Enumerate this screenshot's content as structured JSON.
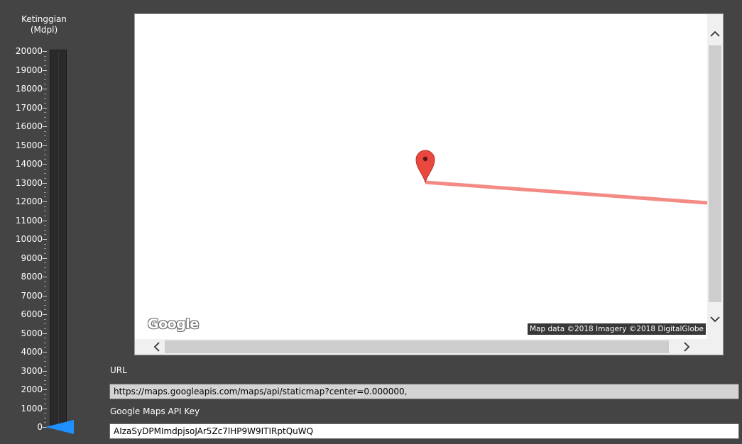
{
  "gauge": {
    "title_line1": "Ketinggian",
    "title_line2": "(Mdpl)",
    "scale_labels": [
      "20000",
      "19000",
      "18000",
      "17000",
      "16000",
      "15000",
      "14000",
      "13000",
      "12000",
      "11000",
      "10000",
      "9000",
      "8000",
      "7000",
      "6000",
      "5000",
      "4000",
      "3000",
      "2000",
      "1000",
      "0"
    ],
    "current_value": 0,
    "max_value": 20000,
    "pointer_color": "#1e90ff"
  },
  "map": {
    "logo_text": "Google",
    "attribution": "Map data ©2018  Imagery ©2018 DigitalGlobe",
    "marker_icon": "map-pin-icon",
    "marker_color": "#e8483e",
    "path_color": "#f48a84"
  },
  "scrollbars": {
    "up_icon": "chevron-up-icon",
    "down_icon": "chevron-down-icon",
    "left_icon": "chevron-left-icon",
    "right_icon": "chevron-right-icon"
  },
  "url": {
    "label": "URL",
    "value": "https://maps.googleapis.com/maps/api/staticmap?center=0.000000,"
  },
  "api_key": {
    "label": "Google Maps API Key",
    "value": "AIzaSyDPMImdpjsoJAr5Zc7lHP9W9ITIRptQuWQ"
  }
}
